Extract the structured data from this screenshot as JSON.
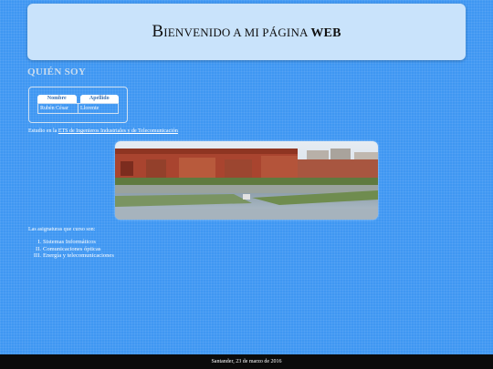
{
  "header": {
    "title_first_letter": "B",
    "title_rest": "IENVENIDO A MI PÁGINA",
    "title_bold": "WEB"
  },
  "about": {
    "heading": "QUIÉN SOY",
    "table": {
      "columns": [
        "Nombre",
        "Apellido"
      ],
      "rows": [
        [
          "Rubén César",
          "Llorente"
        ]
      ]
    }
  },
  "study": {
    "prefix": "Estudio en la",
    "link_text": "ETS de Ingenieros Industriales y de Telecomunicación"
  },
  "subjects": {
    "label": "Las asignaturas que curso son:",
    "items": [
      {
        "num": "I.",
        "text": "Sistemas Informáticos"
      },
      {
        "num": "II.",
        "text": "Comunicaciones ópticas"
      },
      {
        "num": "III.",
        "text": "Energía y telecomunicaciones"
      }
    ]
  },
  "footer": {
    "text": "Santander, 23 de marzo de 2016"
  }
}
